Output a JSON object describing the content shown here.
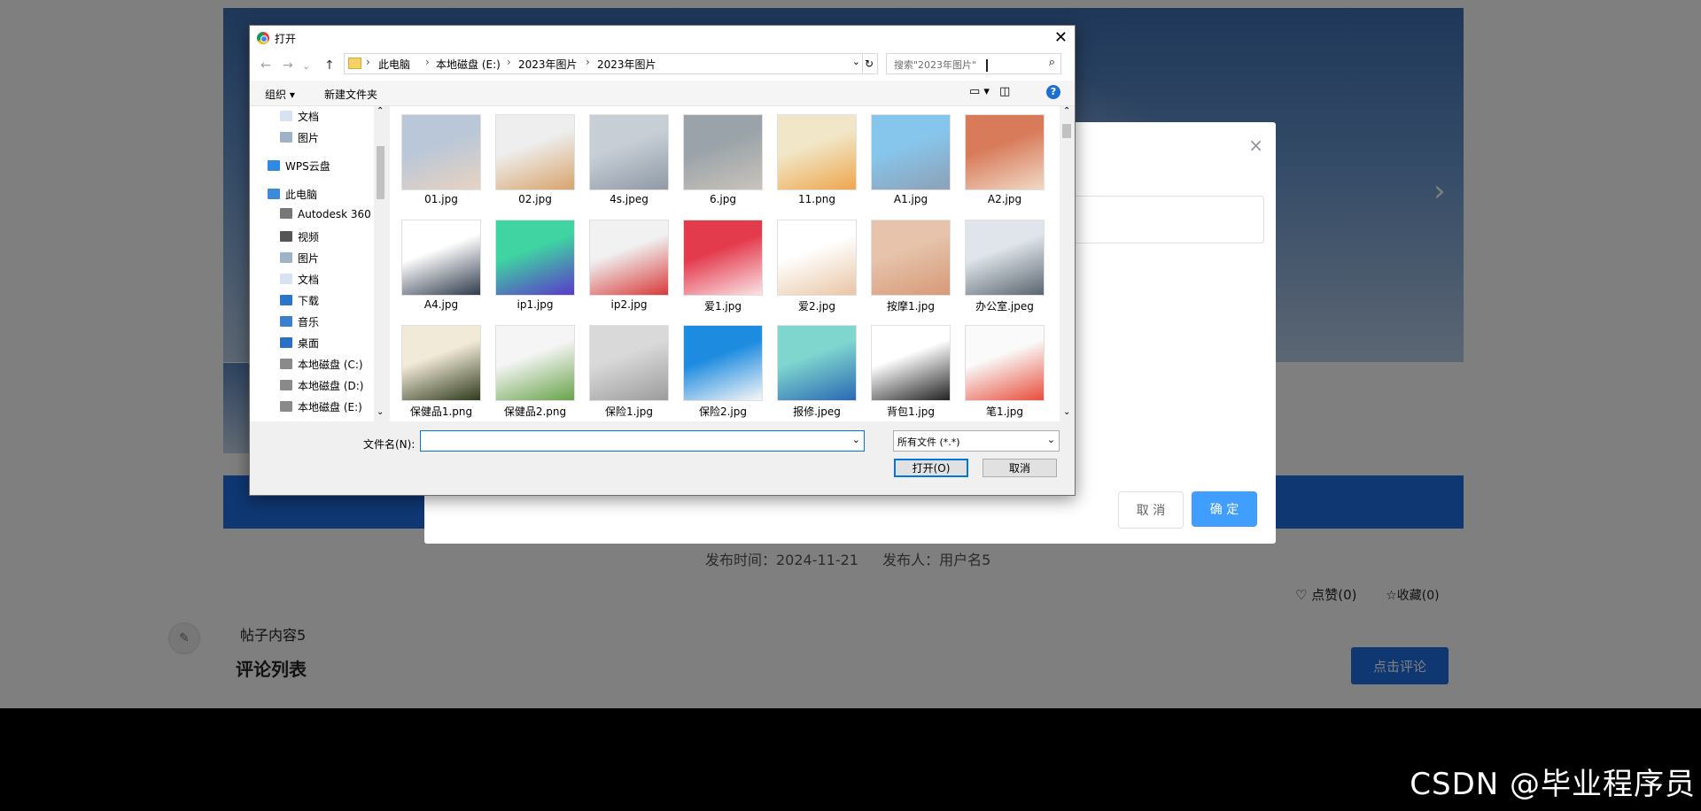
{
  "page": {
    "post_meta": {
      "publish_time": "发布时间：2024-11-21",
      "publisher": "发布人：用户名5"
    },
    "actions": {
      "like": "♡ 点赞(0)",
      "favorite": "☆收藏(0)"
    },
    "post_content": "帖子内容5",
    "comment_title": "评论列表",
    "comment_button": "点击评论",
    "banner_next": "›"
  },
  "modal": {
    "cancel": "取 消",
    "ok": "确 定",
    "close": "×"
  },
  "dialog": {
    "title": "打开",
    "close": "✕",
    "nav": {
      "back": "←",
      "forward": "→",
      "up": "↑",
      "dropdown": "⌄"
    },
    "breadcrumbs": [
      "此电脑",
      "本地磁盘 (E:)",
      "2023年图片",
      "2023年图片"
    ],
    "search_placeholder": "搜索\"2023年图片\"",
    "toolbar": {
      "organize": "组织 ▾",
      "new_folder": "新建文件夹"
    },
    "nav_items": [
      {
        "label": "文档",
        "icon": "document-icon",
        "color": "#d7e3f2",
        "pinned": true
      },
      {
        "label": "图片",
        "icon": "pictures-icon",
        "color": "#9fb3c8",
        "pinned": true
      },
      {
        "label": "WPS云盘",
        "icon": "cloud-icon",
        "color": "#2f8ae5",
        "pinned": false
      },
      {
        "label": "此电脑",
        "icon": "computer-icon",
        "color": "#3d8ad8",
        "pinned": false
      },
      {
        "label": "Autodesk 360",
        "icon": "autodesk-icon",
        "color": "#777777",
        "pinned": false
      },
      {
        "label": "视频",
        "icon": "video-icon",
        "color": "#555555",
        "pinned": false
      },
      {
        "label": "图片",
        "icon": "pictures-icon",
        "color": "#9fb3c8",
        "pinned": false
      },
      {
        "label": "文档",
        "icon": "document-icon",
        "color": "#d7e3f2",
        "pinned": false
      },
      {
        "label": "下载",
        "icon": "download-icon",
        "color": "#2a74c9",
        "pinned": false
      },
      {
        "label": "音乐",
        "icon": "music-icon",
        "color": "#3a7fd0",
        "pinned": false
      },
      {
        "label": "桌面",
        "icon": "desktop-icon",
        "color": "#2b6fc6",
        "pinned": false
      },
      {
        "label": "本地磁盘 (C:)",
        "icon": "drive-icon",
        "color": "#8a8a8a",
        "pinned": false
      },
      {
        "label": "本地磁盘 (D:)",
        "icon": "drive-icon",
        "color": "#8a8a8a",
        "pinned": false
      },
      {
        "label": "本地磁盘 (E:)",
        "icon": "drive-icon",
        "color": "#8a8a8a",
        "pinned": false
      }
    ],
    "files": [
      {
        "name": "01.jpg",
        "colors": [
          "#b9c7d8",
          "#e8d3c2"
        ]
      },
      {
        "name": "02.jpg",
        "colors": [
          "#eeeeee",
          "#d7a46b"
        ]
      },
      {
        "name": "4s.jpeg",
        "colors": [
          "#c7ced6",
          "#8f9aa6"
        ]
      },
      {
        "name": "6.jpg",
        "colors": [
          "#9aa3a9",
          "#c9c3bb"
        ]
      },
      {
        "name": "11.png",
        "colors": [
          "#f1e7c8",
          "#eea64d"
        ]
      },
      {
        "name": "A1.jpg",
        "colors": [
          "#87c6ec",
          "#8da0b6"
        ]
      },
      {
        "name": "A2.jpg",
        "colors": [
          "#d87b5a",
          "#f2d9c6"
        ]
      },
      {
        "name": "A4.jpg",
        "colors": [
          "#ffffff",
          "#2f3a4b"
        ]
      },
      {
        "name": "ip1.jpg",
        "colors": [
          "#3fd4a2",
          "#5a39c9"
        ]
      },
      {
        "name": "ip2.jpg",
        "colors": [
          "#f1f1f1",
          "#d83a3a"
        ]
      },
      {
        "name": "爱1.jpg",
        "colors": [
          "#e33a4c",
          "#fbe3e6"
        ]
      },
      {
        "name": "爱2.jpg",
        "colors": [
          "#ffffff",
          "#e9c5a4"
        ]
      },
      {
        "name": "按摩1.jpg",
        "colors": [
          "#e6c3aa",
          "#d79978"
        ]
      },
      {
        "name": "办公室.jpeg",
        "colors": [
          "#dfe5ea",
          "#5b6570"
        ]
      },
      {
        "name": "保健品1.png",
        "colors": [
          "#f2ead8",
          "#2f3a1c"
        ]
      },
      {
        "name": "保健品2.png",
        "colors": [
          "#f5f5f5",
          "#68a34a"
        ]
      },
      {
        "name": "保险1.jpg",
        "colors": [
          "#d9d9d9",
          "#9c9c9c"
        ]
      },
      {
        "name": "保险2.jpg",
        "colors": [
          "#1c8be0",
          "#f7f7f7"
        ]
      },
      {
        "name": "报修.jpeg",
        "colors": [
          "#7fd6cf",
          "#2a68b3"
        ]
      },
      {
        "name": "背包1.jpg",
        "colors": [
          "#ffffff",
          "#222222"
        ]
      },
      {
        "name": "笔1.jpg",
        "colors": [
          "#fafafa",
          "#e84d3a"
        ]
      }
    ],
    "filename_label": "文件名(N):",
    "filename_value": "",
    "file_type": "所有文件 (*.*)",
    "open_button": "打开(O)",
    "cancel_button": "取消"
  },
  "watermark": "CSDN @毕业程序员"
}
